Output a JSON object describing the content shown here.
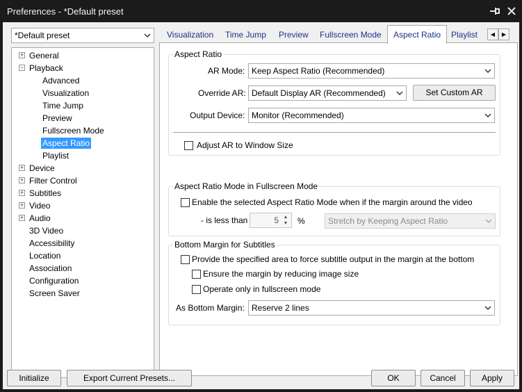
{
  "window": {
    "title": "Preferences - *Default preset",
    "pin_icon": "pin-icon",
    "close_icon": "close-icon"
  },
  "preset_select": {
    "value": "*Default preset"
  },
  "tree": {
    "items": [
      {
        "label": "General",
        "expander": "+"
      },
      {
        "label": "Playback",
        "expander": "−"
      },
      {
        "label": "Advanced"
      },
      {
        "label": "Visualization"
      },
      {
        "label": "Time Jump"
      },
      {
        "label": "Preview"
      },
      {
        "label": "Fullscreen Mode"
      },
      {
        "label": "Aspect Ratio",
        "selected": true
      },
      {
        "label": "Playlist"
      },
      {
        "label": "Device",
        "expander": "+"
      },
      {
        "label": "Filter Control",
        "expander": "+"
      },
      {
        "label": "Subtitles",
        "expander": "+"
      },
      {
        "label": "Video",
        "expander": "+"
      },
      {
        "label": "Audio",
        "expander": "+"
      },
      {
        "label": "3D Video"
      },
      {
        "label": "Accessibility"
      },
      {
        "label": "Location"
      },
      {
        "label": "Association"
      },
      {
        "label": "Configuration"
      },
      {
        "label": "Screen Saver"
      }
    ]
  },
  "tabs": {
    "items": [
      "Visualization",
      "Time Jump",
      "Preview",
      "Fullscreen Mode",
      "Aspect Ratio",
      "Playlist"
    ],
    "active": "Aspect Ratio",
    "scroll_left": "◀",
    "scroll_right": "▶"
  },
  "aspect_ratio": {
    "group_title": "Aspect Ratio",
    "ar_mode_label": "AR Mode:",
    "ar_mode_value": "Keep Aspect Ratio (Recommended)",
    "override_ar_label": "Override AR:",
    "override_ar_value": "Default Display AR (Recommended)",
    "set_custom_ar_button": "Set Custom AR",
    "output_device_label": "Output Device:",
    "output_device_value": "Monitor (Recommended)",
    "adjust_checkbox_label": "Adjust AR to Window Size",
    "adjust_checked": false
  },
  "fullscreen_mode": {
    "group_title": "Aspect Ratio Mode in Fullscreen Mode",
    "enable_checkbox_label": "Enable the selected Aspect Ratio Mode when if the margin around the video",
    "enable_checked": false,
    "is_less_than_label": "- is less than",
    "margin_value": "5",
    "percent_label": "%",
    "stretch_value": "Stretch by Keeping Aspect Ratio"
  },
  "bottom_margin": {
    "group_title": "Bottom Margin for Subtitles",
    "provide_checkbox_label": "Provide the specified area to force subtitle output in the margin at the bottom",
    "provide_checked": false,
    "ensure_checkbox_label": "Ensure the margin by reducing image size",
    "ensure_checked": false,
    "fullscreen_only_checkbox_label": "Operate only in fullscreen mode",
    "fullscreen_only_checked": false,
    "as_bottom_margin_label": "As Bottom Margin:",
    "as_bottom_margin_value": "Reserve 2 lines"
  },
  "footer": {
    "initialize": "Initialize",
    "export": "Export Current Presets...",
    "ok": "OK",
    "cancel": "Cancel",
    "apply": "Apply"
  }
}
